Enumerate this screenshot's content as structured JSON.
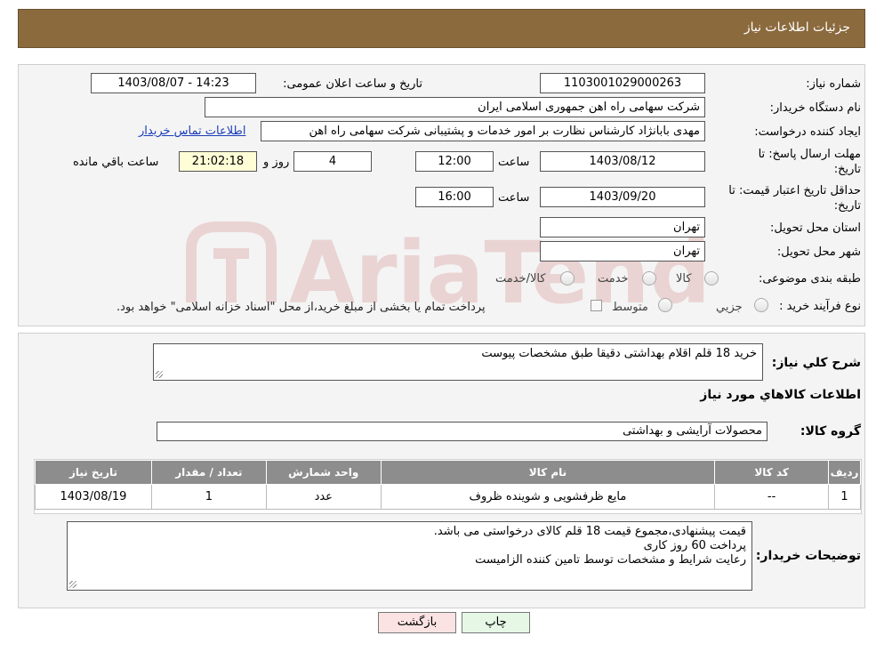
{
  "header": {
    "title": "جزئیات اطلاعات نیاز"
  },
  "form": {
    "need_number_label": "شماره نیاز:",
    "need_number": "1103001029000263",
    "announce_label": "تاریخ و ساعت اعلان عمومی:",
    "announce_value": "1403/08/07 - 14:23",
    "buyer_label": "نام دستگاه خریدار:",
    "buyer_value": "شرکت سهامی راه اهن جمهوری اسلامی ایران",
    "creator_label": "ایجاد کننده درخواست:",
    "creator_value": "مهدی بابانژاد کارشناس نظارت بر امور خدمات و پشتیبانی شرکت سهامی راه اهن",
    "contact_link": "اطلاعات تماس خریدار",
    "deadline_label_1": "مهلت ارسال پاسخ: تا",
    "deadline_label_2": "تاریخ:",
    "deadline_date": "1403/08/12",
    "time_label": "ساعت",
    "deadline_time": "12:00",
    "days_value": "4",
    "days_label": "روز و",
    "remaining_time": "21:02:18",
    "remaining_label": "ساعت باقي مانده",
    "validity_label_1": "حداقل تاریخ اعتبار قیمت: تا",
    "validity_label_2": "تاریخ:",
    "validity_date": "1403/09/20",
    "validity_time": "16:00",
    "province_label": "استان محل تحویل:",
    "province_value": "تهران",
    "city_label": "شهر محل تحویل:",
    "city_value": "تهران",
    "category_label": "طبقه بندی موضوعی:",
    "category_options": [
      "کالا",
      "خدمت",
      "کالا/خدمت"
    ],
    "process_label": "نوع فرآیند خرید :",
    "process_options": [
      "جزیي",
      "متوسط"
    ],
    "process_note": "پرداخت تمام یا بخشی از مبلغ خرید،از محل \"اسناد خزانه اسلامی\" خواهد بود."
  },
  "details": {
    "summary_label": "شرح کلي نياز:",
    "summary_value": "خرید 18 قلم  اقلام بهداشتی دقیقا طبق مشخصات پیوست",
    "goods_info_title": "اطلاعات کالاهاي مورد نياز",
    "goods_group_label": "گروه کالا:",
    "goods_group_value": "محصولات آرایشی و بهداشتی",
    "table_headers": [
      "ردیف",
      "کد کالا",
      "نام کالا",
      "واحد شمارش",
      "تعداد / مقدار",
      "تاریخ نیاز"
    ],
    "table_rows": [
      [
        "1",
        "--",
        "مایع ظرفشویی و شوینده ظروف",
        "عدد",
        "1",
        "1403/08/19"
      ]
    ],
    "buyer_notes_label": "توضیحات خریدار:",
    "buyer_notes_lines": [
      "قیمت پیشنهادی،مجموع قیمت 18 قلم کالای درخواستی می باشد.",
      "پرداخت 60 روز کاری",
      "رعایت شرایط و مشخصات توسط تامین کننده الزامیست"
    ]
  },
  "buttons": {
    "print": "چاپ",
    "back": "بازگشت"
  },
  "colors": {
    "header": "#8b6a3d",
    "table_header": "#8d8d8d",
    "back_button": "#fbe3e3",
    "print_button": "#e6f7e6",
    "remaining_bg": "#fffdd6",
    "link": "#1a3dbb"
  },
  "watermark": {
    "logo_text": "AriaTender.neT"
  }
}
